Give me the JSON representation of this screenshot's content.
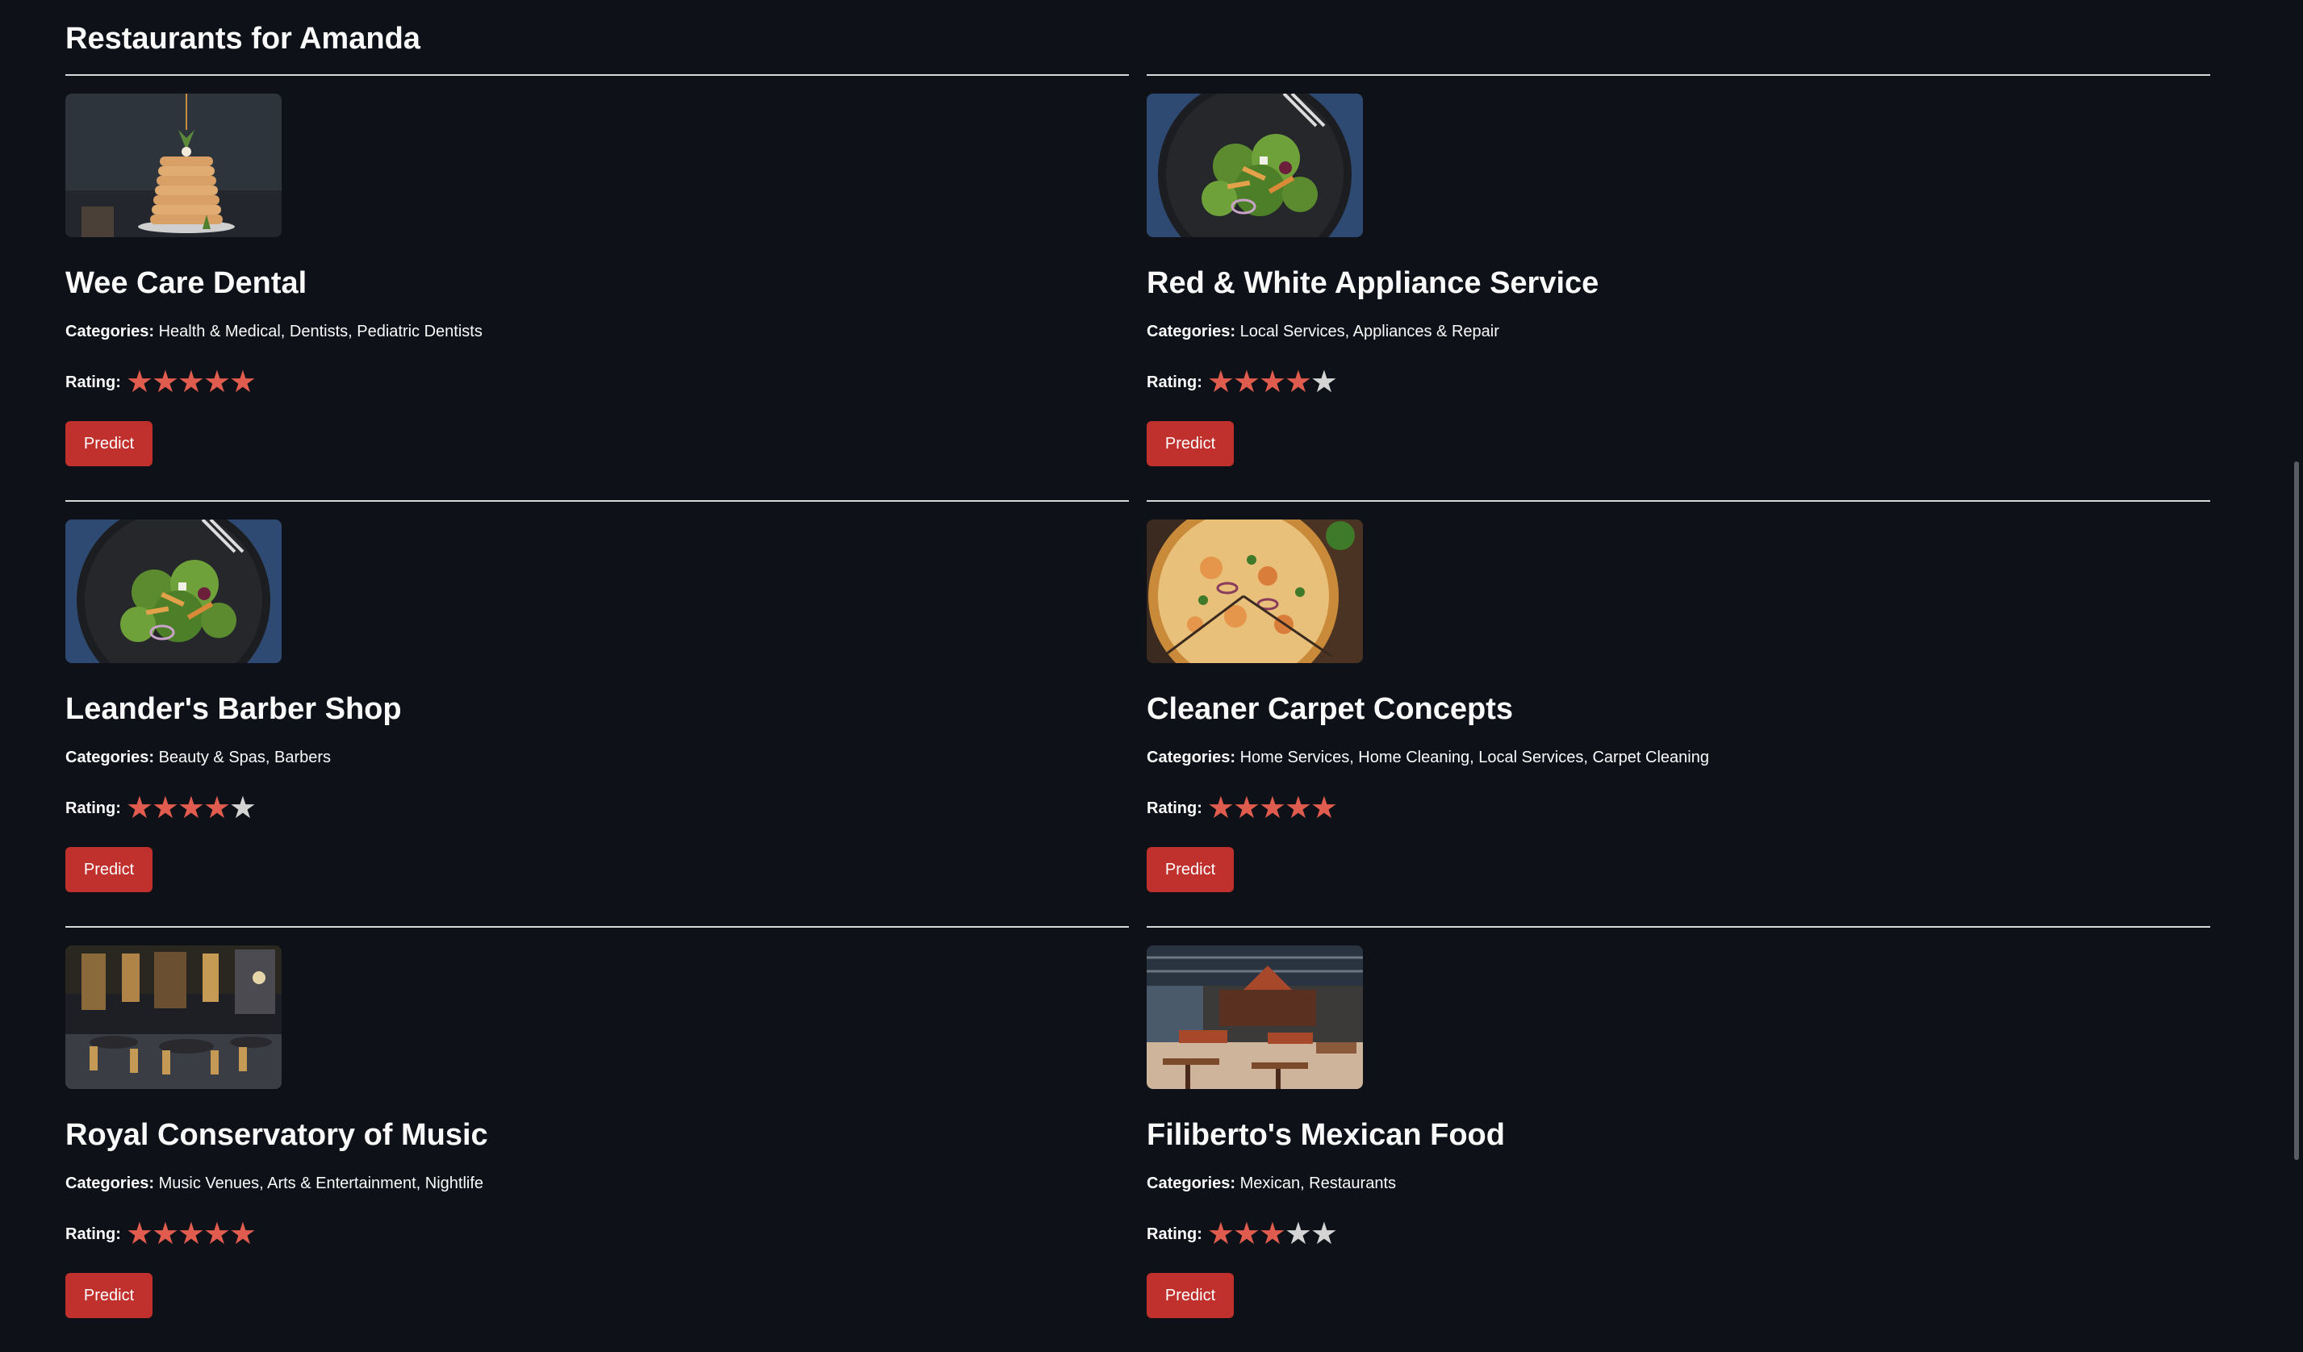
{
  "page": {
    "title": "Restaurants for Amanda"
  },
  "labels": {
    "categories": "Categories:",
    "rating": "Rating:",
    "predict": "Predict"
  },
  "colors": {
    "background": "#0e1117",
    "button": "#c0302c",
    "star_on": "#e05c4f",
    "star_off": "#d4d4d4"
  },
  "restaurants": [
    {
      "name": "Wee Care Dental",
      "categories": "Health & Medical, Dentists, Pediatric Dentists",
      "rating": 5,
      "image": "pancakes"
    },
    {
      "name": "Red & White Appliance Service",
      "categories": "Local Services, Appliances & Repair",
      "rating": 4,
      "image": "salad"
    },
    {
      "name": "Leander's Barber Shop",
      "categories": "Beauty & Spas, Barbers",
      "rating": 4,
      "image": "salad"
    },
    {
      "name": "Cleaner Carpet Concepts",
      "categories": "Home Services, Home Cleaning, Local Services, Carpet Cleaning",
      "rating": 5,
      "image": "pizza"
    },
    {
      "name": "Royal Conservatory of Music",
      "categories": "Music Venues, Arts & Entertainment, Nightlife",
      "rating": 5,
      "image": "dark-restaurant"
    },
    {
      "name": "Filiberto's Mexican Food",
      "categories": "Mexican, Restaurants",
      "rating": 3,
      "image": "bright-restaurant"
    }
  ]
}
